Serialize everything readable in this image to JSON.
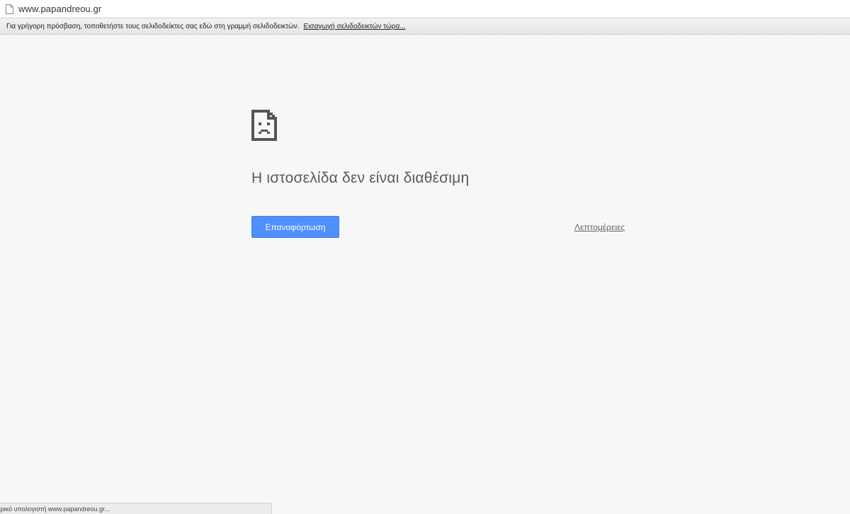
{
  "omnibox": {
    "url": "www.papandreou.gr",
    "page_icon": "page-icon"
  },
  "bookmarks_bar": {
    "prompt": "Για γρήγορη πρόσβαση, τοποθετήστε τους σελιδοδείκτες σας εδώ στη γραμμή σελιδοδεικτών.",
    "import_link": "Εισαγωγή σελιδοδεικτών τώρα..."
  },
  "error": {
    "icon": "sad-page-icon",
    "title": "Η ιστοσελίδα δεν είναι διαθέσιμη",
    "reload_label": "Επαναφόρτωση",
    "details_label": "Λεπτομέρειες"
  },
  "status_bar": {
    "text": "τρικό υπολογιστή www.papandreou.gr..."
  },
  "colors": {
    "accent": "#4d90fe",
    "background": "#f7f7f7"
  }
}
